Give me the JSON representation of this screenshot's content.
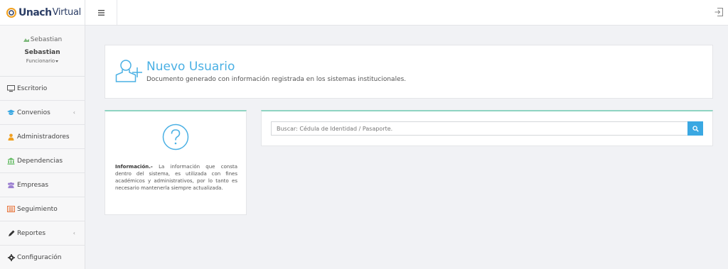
{
  "brand": {
    "bold": "Unach",
    "light": "Virtual"
  },
  "profile": {
    "avatar_alt": "Sebastian",
    "name": "Sebastian",
    "role": "Funcionario"
  },
  "nav": {
    "items": [
      {
        "label": "Escritorio",
        "icon": "desktop-icon"
      },
      {
        "label": "Convenios",
        "icon": "graduation-cap-icon",
        "has_submenu": true
      },
      {
        "label": "Administradores",
        "icon": "user-icon"
      },
      {
        "label": "Dependencias",
        "icon": "bank-icon"
      },
      {
        "label": "Empresas",
        "icon": "users-icon"
      },
      {
        "label": "Seguimiento",
        "icon": "list-icon"
      },
      {
        "label": "Reportes",
        "icon": "pen-icon",
        "has_submenu": true
      },
      {
        "label": "Configuración",
        "icon": "gear-icon"
      }
    ]
  },
  "header": {
    "title": "Nuevo Usuario",
    "subtitle": "Documento generado con información registrada en los sistemas institucionales."
  },
  "info": {
    "label": "Información.-",
    "text": " La información que consta dentro del sistema, es utilizada con fines académicos y administrativos, por lo tanto es necesario mantenerla siempre actualizada."
  },
  "search": {
    "placeholder": "Buscar: Cédula de Identidad / Pasaporte."
  },
  "colors": {
    "accent": "#3aa8e2",
    "title": "#4ab0e4",
    "panel_border_top": "#8ed4c2",
    "brand": "#2c3e66"
  }
}
